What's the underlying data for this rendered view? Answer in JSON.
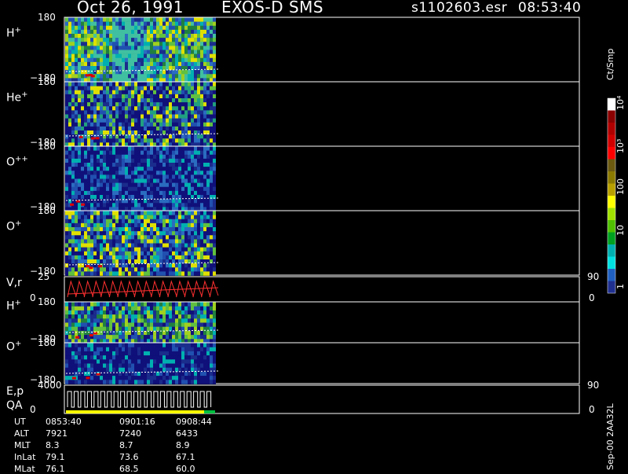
{
  "header": {
    "title": "Oct 26, 1991",
    "instrument": "EXOS-D SMS",
    "file": "s1102603.esr",
    "time": "08:53:40"
  },
  "chart_data": {
    "type": "heatmap",
    "panels": [
      {
        "label": "H",
        "sup": "+",
        "ytick_top": "180",
        "ytick_bottom": "−180",
        "ylim": [
          -180,
          180
        ]
      },
      {
        "label": "He",
        "sup": "+",
        "ytick_top": "180",
        "ytick_bottom": "−180",
        "ylim": [
          -180,
          180
        ]
      },
      {
        "label": "O",
        "sup": "++",
        "ytick_top": "180",
        "ytick_bottom": "−180",
        "ylim": [
          -180,
          180
        ]
      },
      {
        "label": "O",
        "sup": "+",
        "ytick_top": "180",
        "ytick_bottom": "−180",
        "ylim": [
          -180,
          180
        ]
      },
      {
        "label": "V,r",
        "sup": "",
        "ytick_top": "25",
        "ytick_bottom": "0",
        "right_top": "90",
        "right_bottom": "0",
        "ylim": [
          0,
          25
        ],
        "type": "line"
      },
      {
        "label": "H",
        "sup": "+",
        "ytick_top": "180",
        "ytick_bottom": "−180",
        "ylim": [
          -180,
          180
        ]
      },
      {
        "label": "O",
        "sup": "+",
        "ytick_top": "180",
        "ytick_bottom": "−180",
        "ylim": [
          -180,
          180
        ]
      },
      {
        "label": "E,p",
        "label2": "QA",
        "ytick_top": "4000",
        "ytick_bottom": "0",
        "right_top": "90",
        "right_bottom": "0",
        "ylim": [
          0,
          4000
        ],
        "type": "line"
      }
    ],
    "colorbar": {
      "title": "Ct/Smp",
      "ticks": [
        "10⁴",
        "10³",
        "100",
        "10",
        "1"
      ],
      "colors": [
        "#ffffff",
        "#8b0000",
        "#b00000",
        "#d00000",
        "#ff0000",
        "#6b5a10",
        "#8b7a00",
        "#b8a000",
        "#ffff00",
        "#a0e000",
        "#50c000",
        "#00a020",
        "#00b0b0",
        "#00e0e0",
        "#2060c0",
        "#203090"
      ]
    },
    "time_axis": {
      "rows": [
        {
          "name": "UT",
          "values": [
            "0853:40",
            "0901:16",
            "0908:44"
          ]
        },
        {
          "name": "ALT",
          "values": [
            "7921",
            "7240",
            "6433"
          ]
        },
        {
          "name": "MLT",
          "values": [
            "8.3",
            "8.7",
            "8.9"
          ]
        },
        {
          "name": "InLat",
          "values": [
            "79.1",
            "73.6",
            "67.1"
          ]
        },
        {
          "name": "MLat",
          "values": [
            "76.1",
            "68.5",
            "60.0"
          ]
        }
      ]
    },
    "side_note": "Sep-00 2AA32L"
  }
}
